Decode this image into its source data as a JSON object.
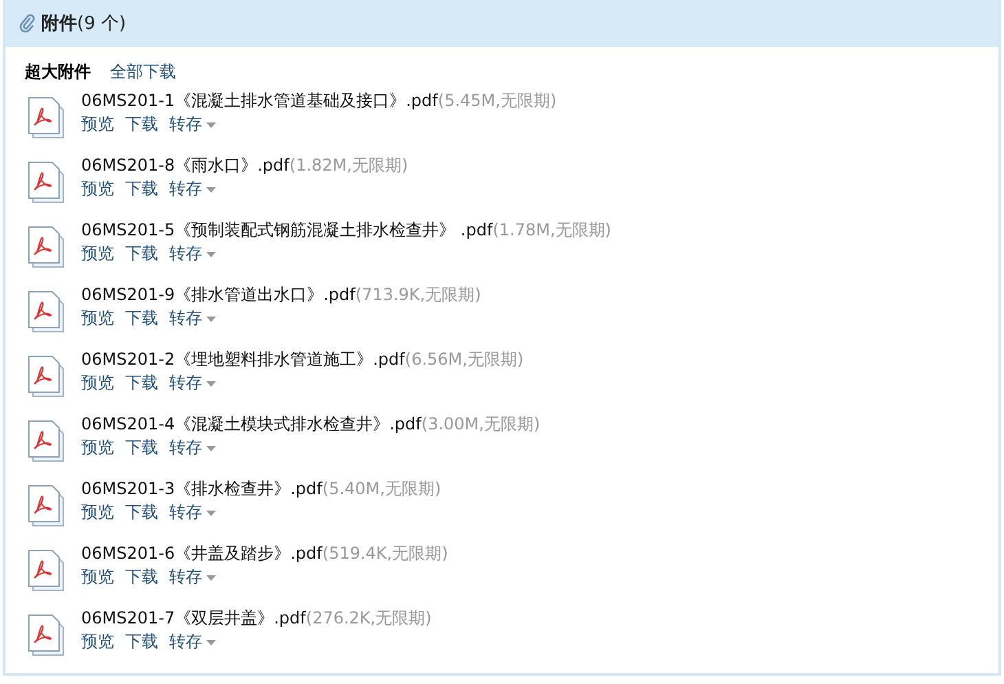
{
  "header": {
    "title": "附件",
    "count": "(9 个)"
  },
  "toolbar": {
    "label": "超大附件",
    "download_all": "全部下载"
  },
  "attachments": [
    {
      "name": "06MS201-1《混凝土排水管道基础及接口》.pdf",
      "info": "(5.45M,无限期)",
      "actions": [
        "预览",
        "下载",
        "转存"
      ]
    },
    {
      "name": "06MS201-8《雨水口》.pdf",
      "info": "(1.82M,无限期)",
      "actions": [
        "预览",
        "下载",
        "转存"
      ]
    },
    {
      "name": "06MS201-5《预制装配式钢筋混凝土排水检查井》 .pdf",
      "info": "(1.78M,无限期)",
      "actions": [
        "预览",
        "下载",
        "转存"
      ]
    },
    {
      "name": "06MS201-9《排水管道出水口》.pdf",
      "info": "(713.9K,无限期)",
      "actions": [
        "预览",
        "下载",
        "转存"
      ]
    },
    {
      "name": "06MS201-2《埋地塑料排水管道施工》.pdf",
      "info": "(6.56M,无限期)",
      "actions": [
        "预览",
        "下载",
        "转存"
      ]
    },
    {
      "name": "06MS201-4《混凝土模块式排水检查井》.pdf",
      "info": "(3.00M,无限期)",
      "actions": [
        "预览",
        "下载",
        "转存"
      ]
    },
    {
      "name": "06MS201-3《排水检查井》.pdf",
      "info": "(5.40M,无限期)",
      "actions": [
        "预览",
        "下载",
        "转存"
      ]
    },
    {
      "name": "06MS201-6《井盖及踏步》.pdf",
      "info": "(519.4K,无限期)",
      "actions": [
        "预览",
        "下载",
        "转存"
      ]
    },
    {
      "name": "06MS201-7《双层井盖》.pdf",
      "info": "(276.2K,无限期)",
      "actions": [
        "预览",
        "下载",
        "转存"
      ]
    }
  ]
}
